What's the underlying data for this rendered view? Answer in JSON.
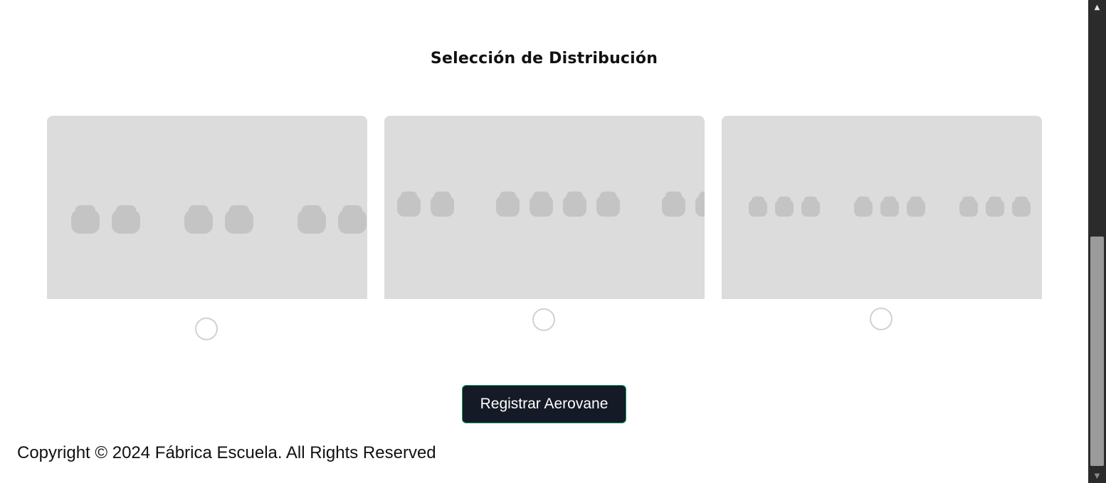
{
  "section": {
    "title": "Selección de Distribución"
  },
  "layouts": [
    {
      "name": "2-2-2 layout",
      "seat_groups": [
        2,
        2,
        2
      ],
      "selected": false
    },
    {
      "name": "2-4-2 layout",
      "seat_groups": [
        2,
        4,
        2
      ],
      "selected": false
    },
    {
      "name": "3-3-3 layout",
      "seat_groups": [
        3,
        3,
        3
      ],
      "selected": false
    }
  ],
  "actions": {
    "register_label": "Registrar Aerovane"
  },
  "footer": {
    "copyright": "Copyright © 2024 Fábrica Escuela. All Rights Reserved"
  },
  "icons": {
    "seat": "seat-icon",
    "scroll_up": "scroll-up-arrow-icon",
    "scroll_down": "scroll-down-arrow-icon"
  },
  "colors": {
    "card_background": "#dcdcdc",
    "seat": "#c4c4c4",
    "button_background": "#141a26",
    "button_border": "#1f9e6e",
    "radio_border": "#d1d1d6"
  }
}
